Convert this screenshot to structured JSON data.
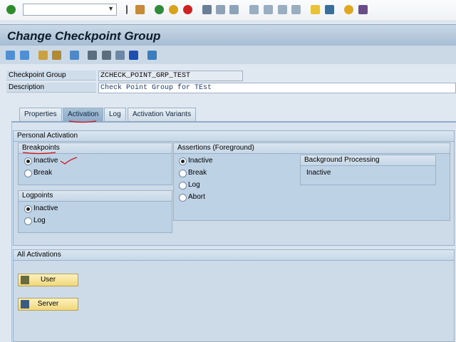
{
  "system_toolbar": {
    "command_field": "",
    "icons": [
      "enter-icon",
      "back-icon",
      "save-icon",
      "back-nav-icon",
      "exit-icon",
      "cancel-icon",
      "print-icon",
      "find-icon",
      "find-next-icon",
      "first-page-icon",
      "prev-page-icon",
      "next-page-icon",
      "last-page-icon",
      "new-session-icon",
      "shortcut-icon",
      "help-icon",
      "layout-icon"
    ]
  },
  "title": "Change Checkpoint Group",
  "app_toolbar": {
    "icons": [
      "back-arrow-icon",
      "forward-arrow-icon",
      "edit-icon",
      "other-object-icon",
      "where-used-icon",
      "hierarchy-icon",
      "display-object-icon",
      "list-icon",
      "info-icon",
      "user-icon"
    ]
  },
  "fields": {
    "group_label": "Checkpoint Group",
    "group_value": "ZCHECK_POINT_GRP_TEST",
    "desc_label": "Description",
    "desc_value": "Check Point Group for TEst"
  },
  "tabs": [
    "Properties",
    "Activation",
    "Log",
    "Activation Variants"
  ],
  "personal": {
    "title": "Personal Activation",
    "breakpoints": {
      "title": "Breakpoints",
      "options": [
        "Inactive",
        "Break"
      ],
      "selected": "Inactive"
    },
    "logpoints": {
      "title": "Logpoints",
      "options": [
        "Inactive",
        "Log"
      ],
      "selected": "Inactive"
    },
    "assertions": {
      "title": "Assertions (Foreground)",
      "options": [
        "Inactive",
        "Break",
        "Log",
        "Abort"
      ],
      "selected": "Inactive"
    },
    "background": {
      "title": "Background Processing",
      "value": "Inactive"
    }
  },
  "all": {
    "title": "All Activations",
    "user_button": "User",
    "server_button": "Server"
  },
  "colors": {
    "accent": "#8eabc8",
    "button": "#f0d779",
    "annotation": "#d01010"
  }
}
